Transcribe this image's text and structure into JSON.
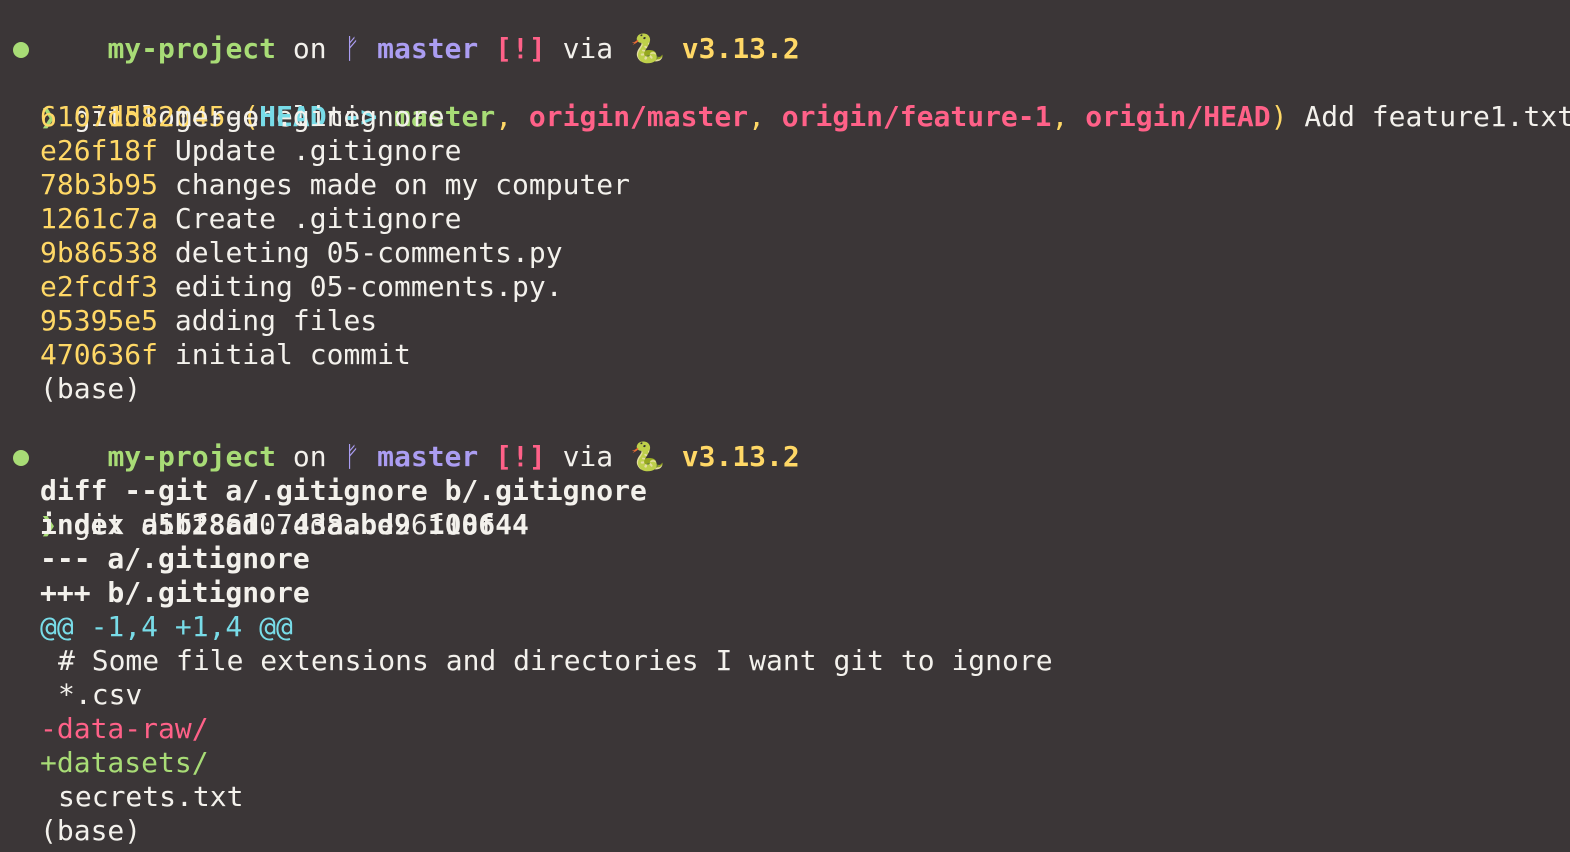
{
  "colors": {
    "background": "#3b3637",
    "foreground": "#f3f1ec",
    "dir": "#a8dc76",
    "branch": "#ab9df2",
    "status": "#ff6188",
    "version": "#ffd866",
    "hash": "#ffd866",
    "head_paren": "#ffd866",
    "head_label": "#78dce8",
    "ref_remote": "#ff6188",
    "ref_local": "#a8dc76",
    "hunk": "#78dce8",
    "removed": "#ff6188",
    "added": "#a8dc76",
    "dot": "#a8dc76",
    "chevron": "#a8dc76"
  },
  "prompt1": {
    "dir": "my-project",
    "on": " on ",
    "branch_icon": "ᚠ",
    "branch": " master",
    "status": " [!]",
    "via": " via ",
    "python_icon": "🐍",
    "version": " v3.13.2",
    "chevron": "❯",
    "command": " git log --oneline"
  },
  "log": {
    "head": {
      "hash": "1532045",
      "paren_open": " (",
      "head_label": "HEAD -> ",
      "local_ref": "master",
      "sep1": ", ",
      "ref2": "origin/master",
      "sep2": ", ",
      "ref3": "origin/feature-1",
      "sep3": ", ",
      "ref4": "origin/HEAD",
      "paren_close": ")",
      "message": " Add feature1.txt"
    },
    "commits": [
      {
        "hash": "6107dd8",
        "message": " merge .gitignore"
      },
      {
        "hash": "e26f18f",
        "message": " Update .gitignore"
      },
      {
        "hash": "78b3b95",
        "message": " changes made on my computer"
      },
      {
        "hash": "1261c7a",
        "message": " Create .gitignore"
      },
      {
        "hash": "9b86538",
        "message": " deleting 05-comments.py"
      },
      {
        "hash": "e2fcdf3",
        "message": " editing 05-comments.py."
      },
      {
        "hash": "95395e5",
        "message": " adding files"
      },
      {
        "hash": "470636f",
        "message": " initial commit"
      }
    ],
    "env": "(base)"
  },
  "prompt2": {
    "dir": "my-project",
    "on": " on ",
    "branch_icon": "ᚠ",
    "branch": " master",
    "status": " [!]",
    "via": " via ",
    "python_icon": "🐍",
    "version": " v3.13.2",
    "chevron": "❯",
    "command": " git diff 6107dd8..e26f18f"
  },
  "diff": {
    "header": "diff --git a/.gitignore b/.gitignore",
    "index": "index a5b28ad..43aabd9 100644",
    "old_file": "--- a/.gitignore",
    "new_file": "+++ b/.gitignore",
    "hunk": "@@ -1,4 +1,4 @@",
    "context1": "# Some file extensions and directories I want git to ignore",
    "context2": "*.csv",
    "removed": "-data-raw/",
    "added": "+datasets/",
    "context3": "secrets.txt",
    "env": "(base)"
  }
}
